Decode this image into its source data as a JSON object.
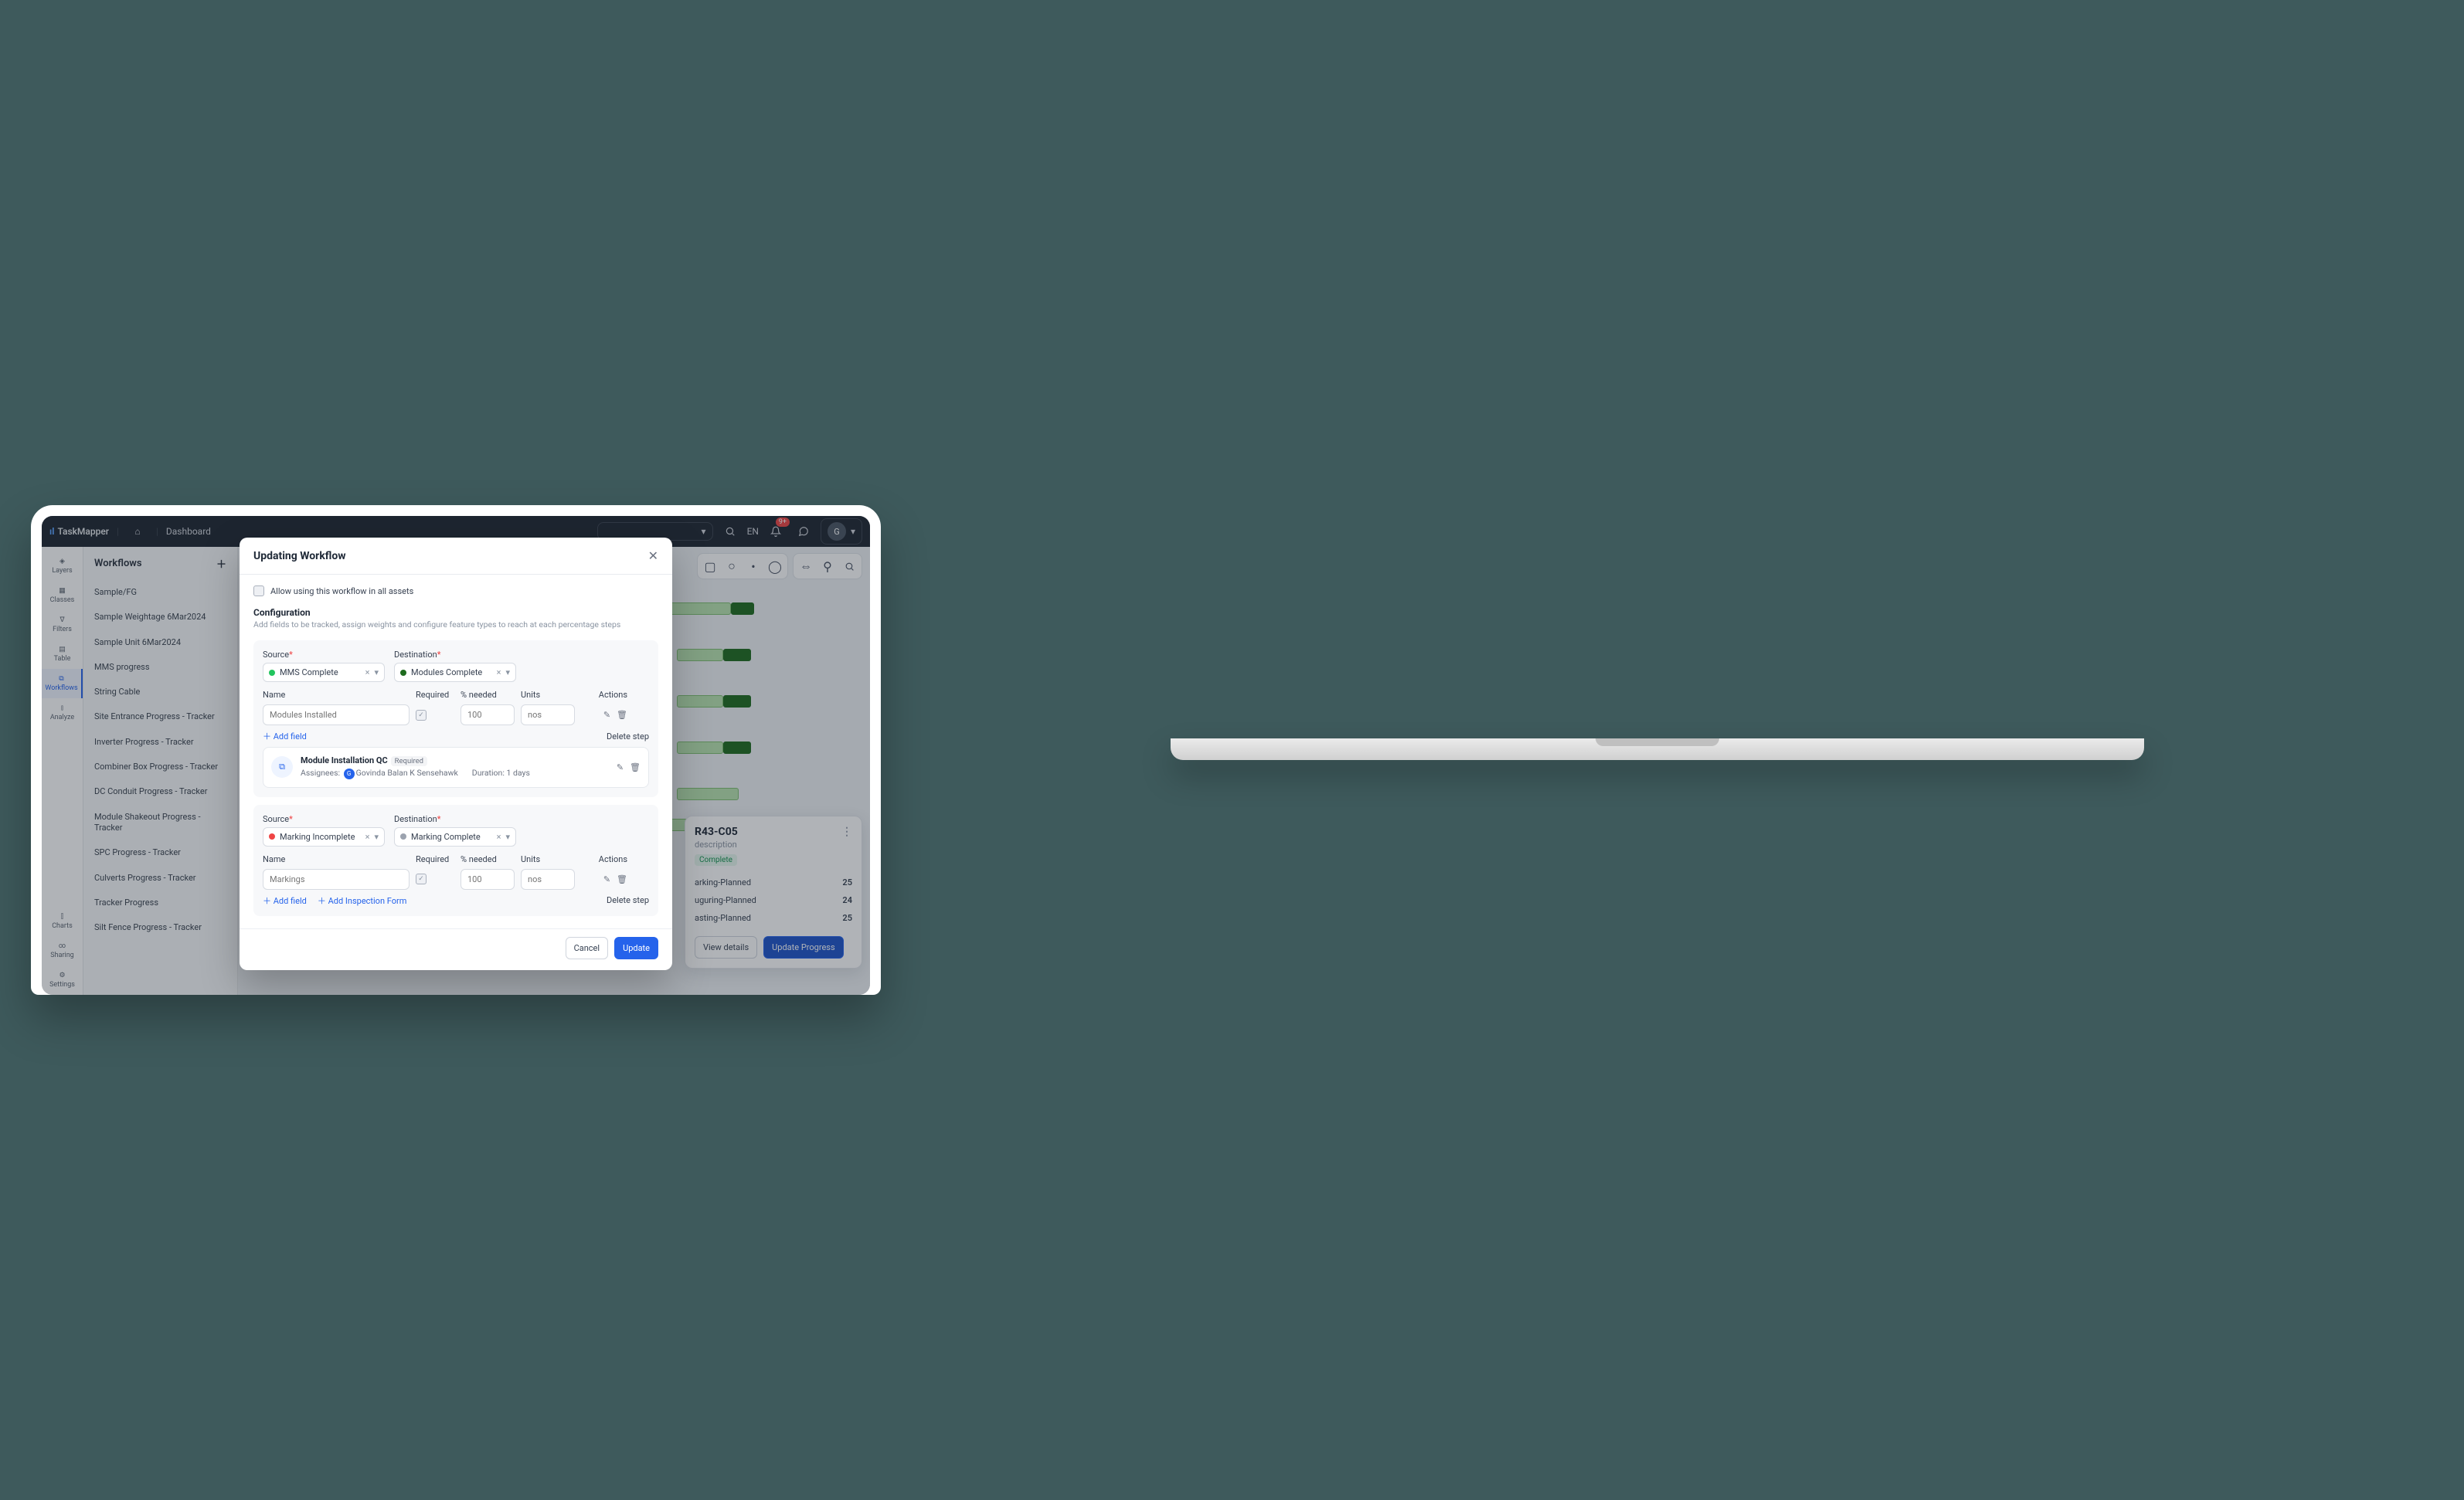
{
  "brand": {
    "name": "TaskMapper"
  },
  "topbar": {
    "crumb": "Dashboard",
    "lang": "EN",
    "notif": "9+",
    "avatar": "G"
  },
  "rail": [
    {
      "label": "Layers"
    },
    {
      "label": "Classes"
    },
    {
      "label": "Filters"
    },
    {
      "label": "Table"
    },
    {
      "label": "Workflows"
    },
    {
      "label": "Analyze"
    },
    {
      "label": "Charts"
    },
    {
      "label": "Sharing"
    },
    {
      "label": "Settings"
    }
  ],
  "sidepanel": {
    "title": "Workflows",
    "items": [
      "Sample/FG",
      "Sample Weightage 6Mar2024",
      "Sample Unit 6Mar2024",
      "MMS progress",
      "String Cable",
      "Site Entrance Progress - Tracker",
      "Inverter Progress - Tracker",
      "Combiner Box Progress - Tracker",
      "DC Conduit Progress - Tracker",
      "Module Shakeout Progress - Tracker",
      "SPC Progress - Tracker",
      "Culverts Progress - Tracker",
      "Tracker Progress",
      "Silt Fence Progress - Tracker"
    ]
  },
  "card": {
    "title": "R43-C05",
    "sub": "description",
    "chip": "Complete",
    "rows": [
      {
        "k": "arking-Planned",
        "v": "25"
      },
      {
        "k": "uguring-Planned",
        "v": "24"
      },
      {
        "k": "asting-Planned",
        "v": "25"
      }
    ],
    "view": "View details",
    "update": "Update Progress"
  },
  "modal": {
    "title": "Updating Workflow",
    "allow": "Allow using this workflow in all assets",
    "config_h": "Configuration",
    "config_hint": "Add fields to be tracked, assign weights and configure feature types to reach at each percentage steps",
    "labels": {
      "source": "Source",
      "dest": "Destination",
      "name": "Name",
      "required": "Required",
      "needed": "% needed",
      "units": "Units",
      "actions": "Actions"
    },
    "add_field": "Add field",
    "add_inspection": "Add Inspection Form",
    "delete": "Delete step",
    "cancel": "Cancel",
    "submit": "Update",
    "steps": [
      {
        "source": {
          "label": "MMS Complete",
          "color": "#22c55e"
        },
        "dest": {
          "label": "Modules Complete",
          "color": "#1e6b1e"
        },
        "fields": [
          {
            "name": "Modules Installed",
            "needed": "100",
            "units": "nos"
          }
        ],
        "qc": {
          "title": "Module Installation QC",
          "tag": "Required",
          "assignee": "Govinda Balan K Sensehawk",
          "duration": "Duration: 1 days"
        },
        "show_inspection": false
      },
      {
        "source": {
          "label": "Marking Incomplete",
          "color": "#ef4444"
        },
        "dest": {
          "label": "Marking Complete",
          "color": "#9ca3af"
        },
        "fields": [
          {
            "name": "Markings",
            "needed": "100",
            "units": "nos"
          }
        ],
        "show_inspection": true
      }
    ]
  }
}
